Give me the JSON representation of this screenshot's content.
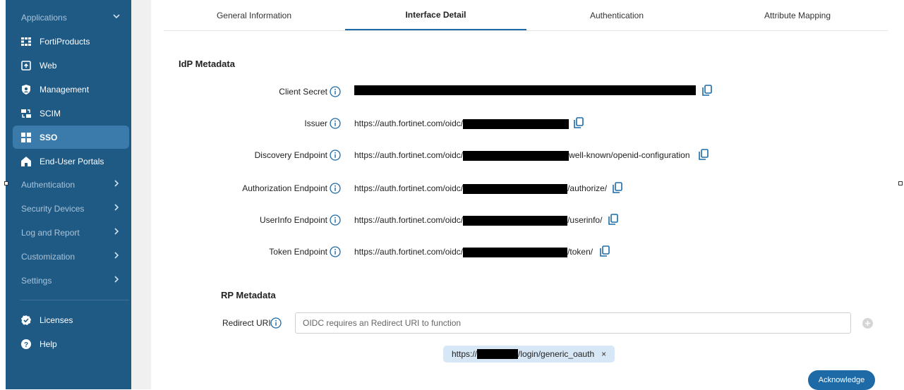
{
  "sidebar": {
    "applications_label": "Applications",
    "items": [
      {
        "label": "FortiProducts",
        "icon": "grid-icon"
      },
      {
        "label": "Web",
        "icon": "web-icon"
      },
      {
        "label": "Management",
        "icon": "shield-icon"
      },
      {
        "label": "SCIM",
        "icon": "sync-icon"
      },
      {
        "label": "SSO",
        "icon": "sso-icon",
        "active": true
      },
      {
        "label": "End-User Portals",
        "icon": "home-icon"
      }
    ],
    "sections": [
      {
        "label": "Authentication"
      },
      {
        "label": "Security Devices"
      },
      {
        "label": "Log and Report"
      },
      {
        "label": "Customization"
      },
      {
        "label": "Settings"
      }
    ],
    "footer": [
      {
        "label": "Licenses",
        "icon": "check-badge-icon"
      },
      {
        "label": "Help",
        "icon": "help-icon"
      }
    ]
  },
  "tabs": [
    {
      "label": "General Information"
    },
    {
      "label": "Interface Detail",
      "active": true
    },
    {
      "label": "Authentication"
    },
    {
      "label": "Attribute Mapping"
    }
  ],
  "idp": {
    "title": "IdP Metadata",
    "rows": [
      {
        "label": "Client Secret",
        "prefix": "",
        "suffix": ""
      },
      {
        "label": "Issuer",
        "prefix": "https://auth.fortinet.com/oidc/",
        "suffix": ""
      },
      {
        "label": "Discovery Endpoint",
        "prefix": "https://auth.fortinet.com/oidc/",
        "suffix": "well-known/openid-configuration"
      },
      {
        "label": "Authorization Endpoint",
        "prefix": "https://auth.fortinet.com/oidc/",
        "suffix": "/authorize/"
      },
      {
        "label": "UserInfo Endpoint",
        "prefix": "https://auth.fortinet.com/oidc/",
        "suffix": "/userinfo/"
      },
      {
        "label": "Token Endpoint",
        "prefix": "https://auth.fortinet.com/oidc/",
        "suffix": "/token/"
      }
    ]
  },
  "rp": {
    "title": "RP Metadata",
    "redirect_label": "Redirect URI",
    "redirect_placeholder": "OIDC requires an Redirect URI to function",
    "chip_prefix": "https://",
    "chip_suffix": "/login/generic_oauth",
    "chip_close": "×"
  },
  "actions": {
    "acknowledge": "Acknowledge"
  },
  "colors": {
    "sidebar_bg": "#1f5a85",
    "active_item": "#3a7bab",
    "accent": "#1d6aa6",
    "chip_bg": "#d7e7f6"
  }
}
